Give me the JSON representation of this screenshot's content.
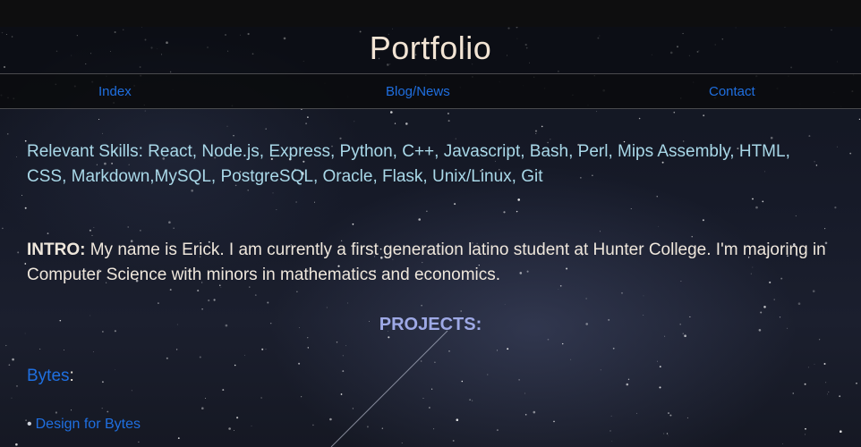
{
  "site": {
    "title": "Portfolio"
  },
  "nav": {
    "items": [
      {
        "label": "Index"
      },
      {
        "label": "Blog/News"
      },
      {
        "label": "Contact"
      }
    ]
  },
  "skills": {
    "text": "Relevant Skills: React, Node.js, Express, Python, C++, Javascript, Bash, Perl, Mips Assembly, HTML, CSS, Markdown,MySQL, PostgreSQL, Oracle, Flask, Unix/Linux, Git"
  },
  "intro": {
    "label": "INTRO:",
    "text": " My name is Erick. I am currently a first generation latino student at Hunter College. I'm majoring in Computer Science with minors in mathematics and economics."
  },
  "projects": {
    "heading": "PROJECTS:",
    "groups": [
      {
        "name": "Bytes",
        "suffix": ":",
        "items": [
          {
            "bullet": "•",
            "label": "Design for Bytes"
          }
        ]
      }
    ]
  },
  "colors": {
    "link": "#1f6fe0",
    "title": "#f2e4d4",
    "skills_text": "#a9d8e8",
    "body_text": "#efe7dc",
    "projects_heading": "#9ea9e6"
  }
}
